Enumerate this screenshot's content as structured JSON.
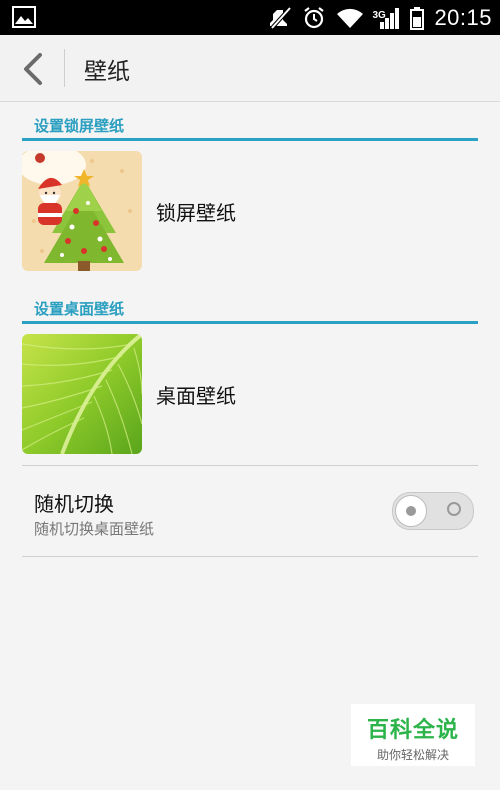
{
  "status_bar": {
    "time": "20:15",
    "network_label": "3G",
    "icons": [
      "image-icon",
      "mute-icon",
      "alarm-icon",
      "wifi-icon",
      "signal-icon",
      "battery-icon"
    ]
  },
  "titlebar": {
    "title": "壁纸",
    "back_icon": "chevron-left-icon"
  },
  "lock_section": {
    "header": "设置锁屏壁纸",
    "item_label": "锁屏壁纸"
  },
  "home_section": {
    "header": "设置桌面壁纸",
    "item_label": "桌面壁纸"
  },
  "random_switch": {
    "title": "随机切换",
    "subtitle": "随机切换桌面壁纸",
    "enabled": false
  },
  "watermark": {
    "main": "百科全说",
    "sub": "助你轻松解决"
  },
  "colors": {
    "accent": "#2aa0c2",
    "brand_green": "#2cb34a"
  }
}
